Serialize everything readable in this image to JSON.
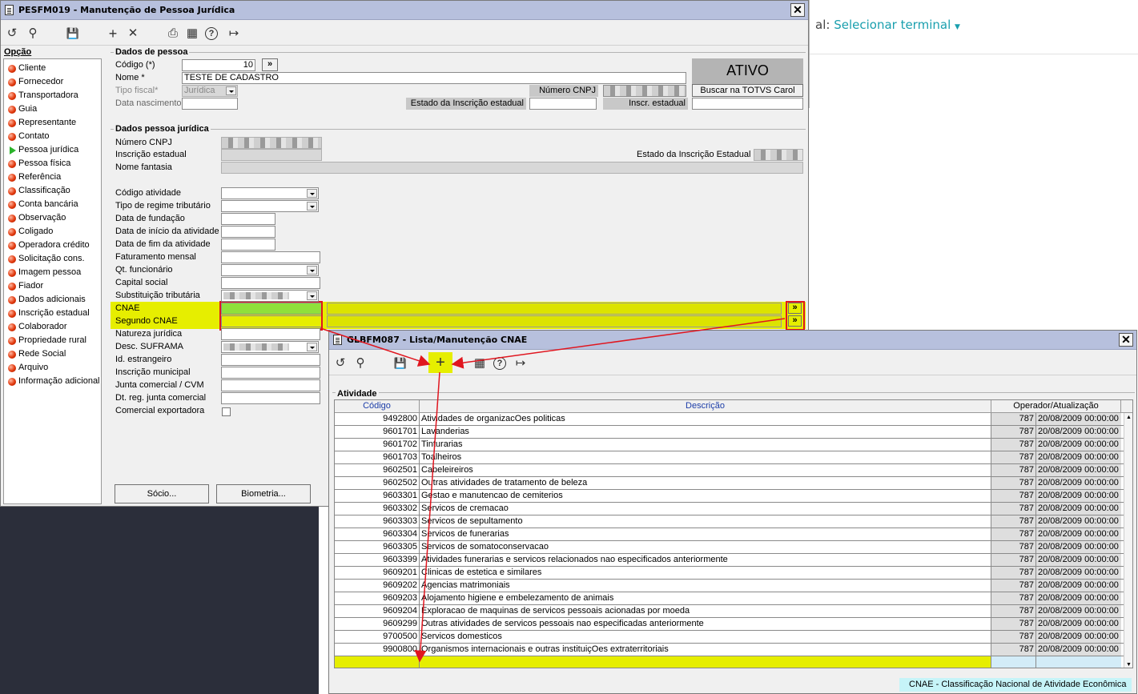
{
  "background": {
    "terminal_prefix": "al:",
    "terminal_label": "Selecionar terminal"
  },
  "main": {
    "title": "PESFM019 - Manutenção de Pessoa Jurídica",
    "toolbar": {
      "undo": "↺",
      "search": "⚲",
      "save": "💾",
      "add": "+",
      "delete": "✕",
      "print": "⎙",
      "calendar": "▦",
      "help": "?",
      "exit": "↦"
    },
    "options_header": "Opção",
    "options": [
      "Cliente",
      "Fornecedor",
      "Transportadora",
      "Guia",
      "Representante",
      "Contato",
      "Pessoa jurídica",
      "Pessoa física",
      "Referência",
      "Classificação",
      "Conta bancária",
      "Observação",
      "Coligado",
      "Operadora crédito",
      "Solicitação cons.",
      "Imagem pessoa",
      "Fiador",
      "Dados adicionais",
      "Inscrição estadual",
      "Colaborador",
      "Propriedade rural",
      "Rede Social",
      "Arquivo",
      "Informação adicional"
    ],
    "dados_pessoa": {
      "title": "Dados de pessoa",
      "codigo_label": "Código (*)",
      "codigo_value": "10",
      "codigo_btn": "»",
      "nome_label": "Nome *",
      "nome_value": "TESTE DE CADASTRO",
      "tipo_fiscal_label": "Tipo fiscal*",
      "tipo_fiscal_value": "Jurídica",
      "data_nasc_label": "Data nascimento",
      "numero_cnpj_label": "Número CNPJ",
      "estado_insc_label": "Estado da Inscrição estadual",
      "inscr_estadual_label": "Inscr. estadual",
      "status": "ATIVO",
      "carol_btn": "Buscar na TOTVS Carol"
    },
    "dados_juridica": {
      "title": "Dados pessoa jurídica",
      "numero_cnpj_label": "Número CNPJ",
      "insc_estadual_label": "Inscrição estadual",
      "nome_fantasia_label": "Nome fantasia",
      "estado_insc_label": "Estado da Inscrição Estadual",
      "fields": [
        "Código atividade",
        "Tipo de regime tributário",
        "Data de fundação",
        "Data de início da atividade",
        "Data de fim da atividade",
        "Faturamento mensal",
        "Qt. funcionário",
        "Capital social",
        "Substituição tributária",
        "CNAE",
        "Segundo CNAE",
        "Natureza jurídica",
        "Desc. SUFRAMA",
        "Id. estrangeiro",
        "Inscrição municipal",
        "Junta comercial / CVM",
        "Dt. reg. junta comercial",
        "Comercial exportadora"
      ],
      "more_btn": "»"
    },
    "socio_btn": "Sócio...",
    "biometria_btn": "Biometria..."
  },
  "cnae": {
    "title": "GLBFM087 - Lista/Manutenção CNAE",
    "toolbar": {
      "undo": "↺",
      "search": "⚲",
      "save": "💾",
      "add": "+",
      "calendar": "▦",
      "help": "?",
      "exit": "↦"
    },
    "group_title": "Atividade",
    "columns": {
      "codigo": "Código",
      "descricao": "Descrição",
      "operador": "Operador/Atualização"
    },
    "rows": [
      {
        "codigo": "9492800",
        "descricao": "Atividades de organizacOes politicas",
        "op": "787",
        "data": "20/08/2009 00:00:00"
      },
      {
        "codigo": "9601701",
        "descricao": "Lavanderias",
        "op": "787",
        "data": "20/08/2009 00:00:00"
      },
      {
        "codigo": "9601702",
        "descricao": "Tinturarias",
        "op": "787",
        "data": "20/08/2009 00:00:00"
      },
      {
        "codigo": "9601703",
        "descricao": "Toalheiros",
        "op": "787",
        "data": "20/08/2009 00:00:00"
      },
      {
        "codigo": "9602501",
        "descricao": "Cabeleireiros",
        "op": "787",
        "data": "20/08/2009 00:00:00"
      },
      {
        "codigo": "9602502",
        "descricao": "Outras atividades de tratamento de beleza",
        "op": "787",
        "data": "20/08/2009 00:00:00"
      },
      {
        "codigo": "9603301",
        "descricao": "Gestao e manutencao de cemiterios",
        "op": "787",
        "data": "20/08/2009 00:00:00"
      },
      {
        "codigo": "9603302",
        "descricao": "Servicos de cremacao",
        "op": "787",
        "data": "20/08/2009 00:00:00"
      },
      {
        "codigo": "9603303",
        "descricao": "Servicos de sepultamento",
        "op": "787",
        "data": "20/08/2009 00:00:00"
      },
      {
        "codigo": "9603304",
        "descricao": "Servicos de funerarias",
        "op": "787",
        "data": "20/08/2009 00:00:00"
      },
      {
        "codigo": "9603305",
        "descricao": "Servicos de somatoconservacao",
        "op": "787",
        "data": "20/08/2009 00:00:00"
      },
      {
        "codigo": "9603399",
        "descricao": "Atividades funerarias e servicos relacionados nao especificados anteriormente",
        "op": "787",
        "data": "20/08/2009 00:00:00"
      },
      {
        "codigo": "9609201",
        "descricao": "Clinicas de estetica e similares",
        "op": "787",
        "data": "20/08/2009 00:00:00"
      },
      {
        "codigo": "9609202",
        "descricao": "Agencias matrimoniais",
        "op": "787",
        "data": "20/08/2009 00:00:00"
      },
      {
        "codigo": "9609203",
        "descricao": "Alojamento  higiene e embelezamento de animais",
        "op": "787",
        "data": "20/08/2009 00:00:00"
      },
      {
        "codigo": "9609204",
        "descricao": "Exploracao de maquinas de servicos pessoais acionadas por moeda",
        "op": "787",
        "data": "20/08/2009 00:00:00"
      },
      {
        "codigo": "9609299",
        "descricao": "Outras atividades de servicos pessoais nao especificadas anteriormente",
        "op": "787",
        "data": "20/08/2009 00:00:00"
      },
      {
        "codigo": "9700500",
        "descricao": "Servicos domesticos",
        "op": "787",
        "data": "20/08/2009 00:00:00"
      },
      {
        "codigo": "9900800",
        "descricao": "Organismos internacionais e outras instituiçOes extraterritoriais",
        "op": "787",
        "data": "20/08/2009 00:00:00"
      }
    ],
    "status_text": "CNAE - Classificação Nacional de Atividade Econômica"
  },
  "colors": {
    "highlight": "#e6ee00",
    "annotation": "#e0161f",
    "titlebar": "#b7c0dd",
    "link": "#1a9fae"
  }
}
